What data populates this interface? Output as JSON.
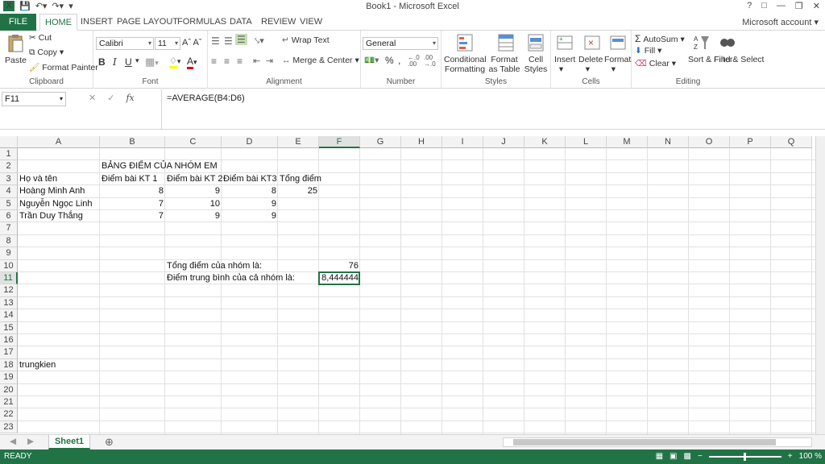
{
  "app": {
    "title": "Book1 - Microsoft Excel",
    "logo": "X",
    "account": "Microsoft account"
  },
  "ribbon_tabs": [
    "FILE",
    "HOME",
    "INSERT",
    "PAGE LAYOUT",
    "FORMULAS",
    "DATA",
    "REVIEW",
    "VIEW"
  ],
  "active_tab": "HOME",
  "clipboard": {
    "paste": "Paste",
    "cut": "Cut",
    "copy": "Copy",
    "format_painter": "Format Painter",
    "label": "Clipboard"
  },
  "font": {
    "name": "Calibri",
    "size": "11",
    "label": "Font",
    "bold": "B",
    "italic": "I",
    "underline": "U"
  },
  "alignment": {
    "wrap": "Wrap Text",
    "merge": "Merge & Center",
    "label": "Alignment"
  },
  "number": {
    "format": "General",
    "label": "Number",
    "percent": "%",
    "comma": ","
  },
  "styles": {
    "cond": "Conditional Formatting",
    "fmt_table": "Format as Table",
    "cell_styles": "Cell Styles",
    "label": "Styles"
  },
  "cells_grp": {
    "insert": "Insert",
    "delete": "Delete",
    "format": "Format",
    "label": "Cells"
  },
  "editing": {
    "autosum": "AutoSum",
    "fill": "Fill",
    "clear": "Clear",
    "sort": "Sort & Filter",
    "find": "Find & Select",
    "label": "Editing"
  },
  "name_box": "F11",
  "formula": "=AVERAGE(B4:D6)",
  "columns": [
    "A",
    "B",
    "C",
    "D",
    "E",
    "F",
    "G",
    "H",
    "I",
    "J",
    "K",
    "L",
    "M",
    "N",
    "O",
    "P",
    "Q"
  ],
  "rows": [
    "1",
    "2",
    "3",
    "4",
    "5",
    "6",
    "7",
    "8",
    "9",
    "10",
    "11",
    "12",
    "13",
    "14",
    "15",
    "16",
    "17",
    "18",
    "19",
    "20",
    "21",
    "22",
    "23"
  ],
  "selected_col": "F",
  "selected_row": "11",
  "sheet": {
    "b2": "BẢNG ĐIỂM CỦA NHÓM EM",
    "a3": "Họ và tên",
    "b3": "Điểm bài KT 1",
    "c3": "Điểm bài KT 2",
    "d3": "Điểm bài KT3",
    "e3": "Tổng điểm",
    "a4": "Hoàng Minh Anh",
    "b4": "8",
    "c4": "9",
    "d4": "8",
    "e4": "25",
    "a5": "Nguyễn Ngọc Linh",
    "b5": "7",
    "c5": "10",
    "d5": "9",
    "a6": "Trần Duy Thắng",
    "b6": "7",
    "c6": "9",
    "d6": "9",
    "c10": "Tổng điểm của nhóm là:",
    "f10": "76",
    "c11": "Điểm trung bình của cả nhóm là:",
    "f11": "8,444444",
    "a18": "trungkien"
  },
  "sheet_tab": "Sheet1",
  "status": {
    "ready": "READY",
    "zoom": "100 %"
  }
}
